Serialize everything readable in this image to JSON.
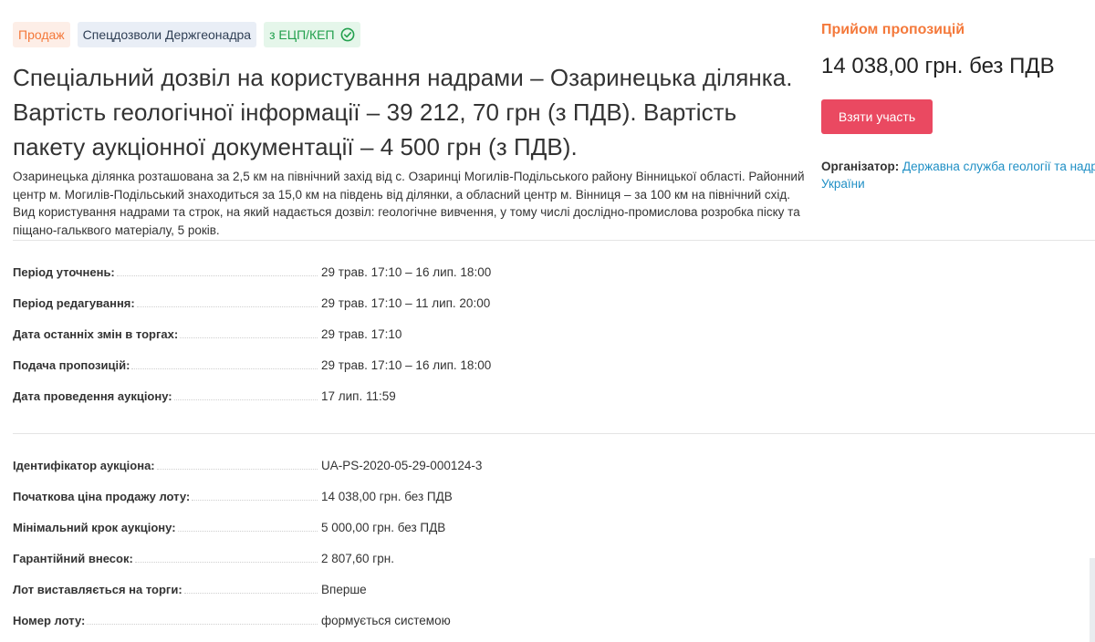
{
  "tags": {
    "sale": "Продаж",
    "category": "Спецдозволи Держгеонадра",
    "signature": "з ЕЦП/КЕП"
  },
  "title": "Спеціальний дозвіл на користування надрами – Озаринецька ділянка. Вартість геологічної інформації – 39 212, 70 грн (з ПДВ). Вартість пакету аукціонної документації – 4 500 грн (з ПДВ).",
  "description": "Озаринецька ділянка розташована за 2,5 км на північний захід від с. Озаринці Могилів-Подільського району Вінницької області. Районний центр м. Могилів-Подільський знаходиться за 15,0 км на південь від ділянки, а обласний центр м. Вінниця – за 100 км на північний схід. Вид користування надрами та строк, на який надається дозвіл: геологічне вивчення, у тому числі дослідно-промислова розробка піску та піщано-гальквого матеріалу, 5 років.",
  "periods": [
    {
      "label": "Період уточнень:",
      "value": "29 трав. 17:10 – 16 лип. 18:00"
    },
    {
      "label": "Період редагування:",
      "value": "29 трав. 17:10 – 11 лип. 20:00"
    },
    {
      "label": "Дата останніх змін в торгах:",
      "value": "29 трав. 17:10"
    },
    {
      "label": "Подача пропозицій:",
      "value": "29 трав. 17:10 – 16 лип. 18:00"
    },
    {
      "label": "Дата проведення аукціону:",
      "value": "17 лип. 11:59"
    }
  ],
  "info": [
    {
      "label": "Ідентифікатор аукціона:",
      "value": "UA-PS-2020-05-29-000124-3"
    },
    {
      "label": "Початкова ціна продажу лоту:",
      "value": "14 038,00 грн. без ПДВ"
    },
    {
      "label": "Мінімальний крок аукціону:",
      "value": "5 000,00 грн. без ПДВ"
    },
    {
      "label": "Гарантійний внесок:",
      "value": "2 807,60 грн."
    },
    {
      "label": "Лот виставляється на торги:",
      "value": "Вперше"
    },
    {
      "label": "Номер лоту:",
      "value": "формується системою"
    }
  ],
  "side": {
    "status": "Прийом пропозицій",
    "price": "14 038,00 грн. без ПДВ",
    "join_label": "Взяти участь",
    "organizer_label": "Організатор:",
    "organizer_name_1": "Державна служба геології та надр",
    "organizer_name_2": "України"
  },
  "colors": {
    "accent_orange": "#f4793b",
    "button_red": "#ea4961",
    "link_blue": "#1f8fc5",
    "success_green": "#23a04e"
  }
}
